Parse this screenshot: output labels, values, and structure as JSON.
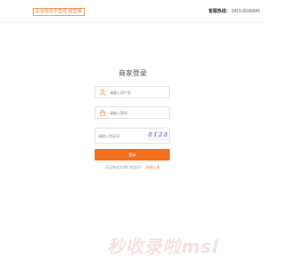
{
  "header": {
    "brand_text": "企业信息中营范 经营赋",
    "hotline_label": "客服热线：",
    "hotline_number": "0415-6696686"
  },
  "login": {
    "title": "商家登录",
    "username_placeholder": "请输入用户名",
    "password_placeholder": "请输入密码",
    "captcha_placeholder": "请输入验证码",
    "captcha_text": "0120",
    "submit_label": "登录",
    "register_prompt": "还没有成为我们的会员？",
    "register_link": "申请入驻"
  },
  "watermark": "秒收录啦msl",
  "icons": {
    "username": "user-icon",
    "password": "lock-icon"
  },
  "colors": {
    "accent": "#f36f1b",
    "link": "#f07a2a"
  }
}
